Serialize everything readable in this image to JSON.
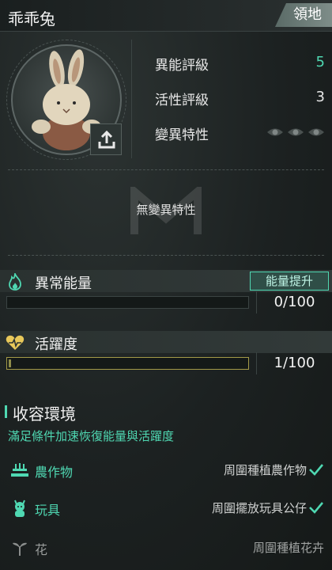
{
  "header": {
    "title": "乖乖兔",
    "territory_label": "領地"
  },
  "stats": [
    {
      "label": "異能評級",
      "value": "5",
      "accent": "#4fd8b2"
    },
    {
      "label": "活性評級",
      "value": "3"
    },
    {
      "label": "變異特性",
      "icons": [
        "eye-icon",
        "eye-icon",
        "eye-icon"
      ]
    }
  ],
  "mutation": {
    "empty_text": "無變異特性"
  },
  "energy": {
    "label": "異常能量",
    "button": "能量提升",
    "value": "0/100",
    "current": 0,
    "max": 100
  },
  "activity": {
    "label": "活躍度",
    "value": "1/100",
    "current": 1,
    "max": 100
  },
  "environment": {
    "title": "收容環境",
    "subtitle": "滿足條件加速恢復能量與活躍度",
    "items": [
      {
        "icon": "crops-icon",
        "label": "農作物",
        "condition": "周圍種植農作物",
        "met": true
      },
      {
        "icon": "toy-icon",
        "label": "玩具",
        "condition": "周圍擺放玩具公仔",
        "met": true
      },
      {
        "icon": "flower-icon",
        "label": "花",
        "condition": "周圍種植花卉",
        "met": false
      }
    ]
  },
  "colors": {
    "accent": "#4fd8b2",
    "gold": "#a39a48"
  }
}
